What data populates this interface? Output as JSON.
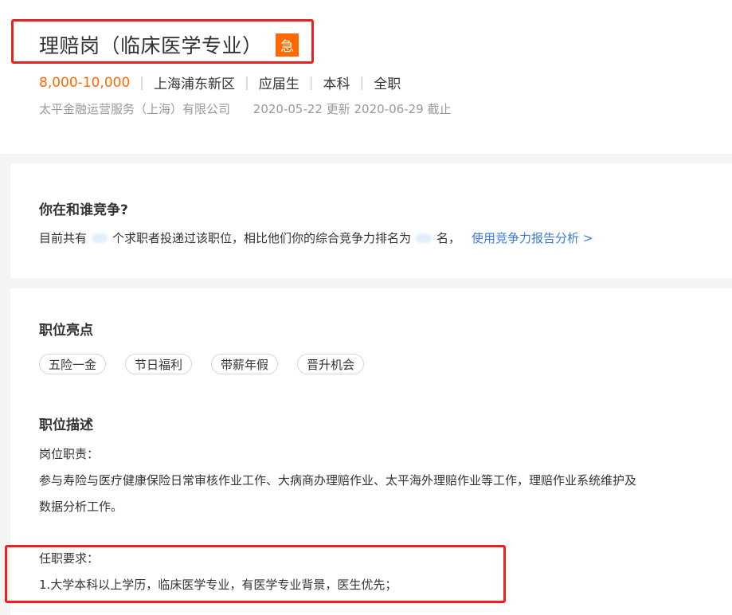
{
  "job": {
    "title": "理赔岗（临床医学专业）",
    "urgent_badge": "急",
    "salary": "8,000-10,000",
    "location": "上海浦东新区",
    "experience": "应届生",
    "education": "本科",
    "job_type": "全职",
    "company": "太平金融运营服务（上海）有限公司",
    "dates": "2020-05-22 更新 2020-06-29 截止",
    "separator": "|"
  },
  "competition": {
    "heading": "你在和谁竞争?",
    "text_part1": "目前共有",
    "text_part2": "个求职者投递过该职位，相比他们你的综合竞争力排名为",
    "text_part3": "名，",
    "link": "使用竞争力报告分析 >"
  },
  "highlights": {
    "heading": "职位亮点",
    "tags": [
      "五险一金",
      "节日福利",
      "带薪年假",
      "晋升机会"
    ]
  },
  "description": {
    "heading": "职位描述",
    "duties_label": "岗位职责：",
    "duties_line1": "参与寿险与医疗健康保险日常审核作业工作、大病商办理赔作业、太平海外理赔作业等工作，理赔作业系统维护及",
    "duties_line2": "数据分析工作。",
    "requirements_label": "任职要求：",
    "requirements_line1": "1.大学本科以上学历，临床医学专业，有医学专业背景，医生优先；"
  },
  "colors": {
    "accent_orange": "#ff6a00",
    "link_blue": "#3b7bd8",
    "highlight_red": "#e8221e"
  }
}
